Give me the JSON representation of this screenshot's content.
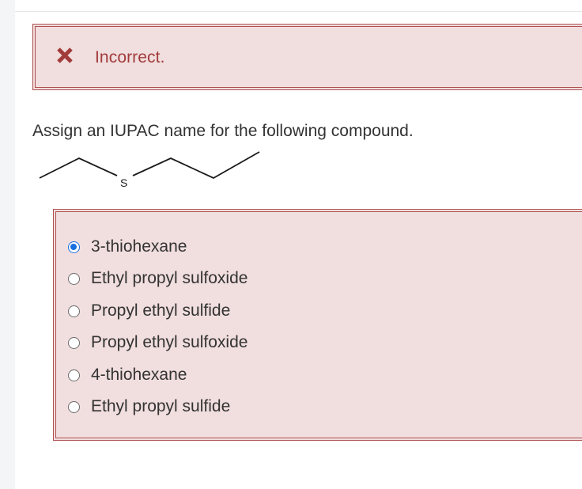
{
  "feedback": {
    "status_text": "Incorrect.",
    "icon": "close-x-icon",
    "background_color": "#f1dede",
    "accent_color": "#a23b3b"
  },
  "question": {
    "prompt": "Assign an IUPAC name for the following compound.",
    "structure_atom_label": "S"
  },
  "choices": {
    "selected_index": 0,
    "options": [
      {
        "label": "3-thiohexane",
        "selected": true
      },
      {
        "label": "Ethyl propyl sulfoxide",
        "selected": false
      },
      {
        "label": "Propyl ethyl sulfide",
        "selected": false
      },
      {
        "label": "Propyl ethyl sulfoxide",
        "selected": false
      },
      {
        "label": "4-thiohexane",
        "selected": false
      },
      {
        "label": "Ethyl propyl sulfide",
        "selected": false
      }
    ],
    "radio_selected_color": "#1a6fe0"
  }
}
